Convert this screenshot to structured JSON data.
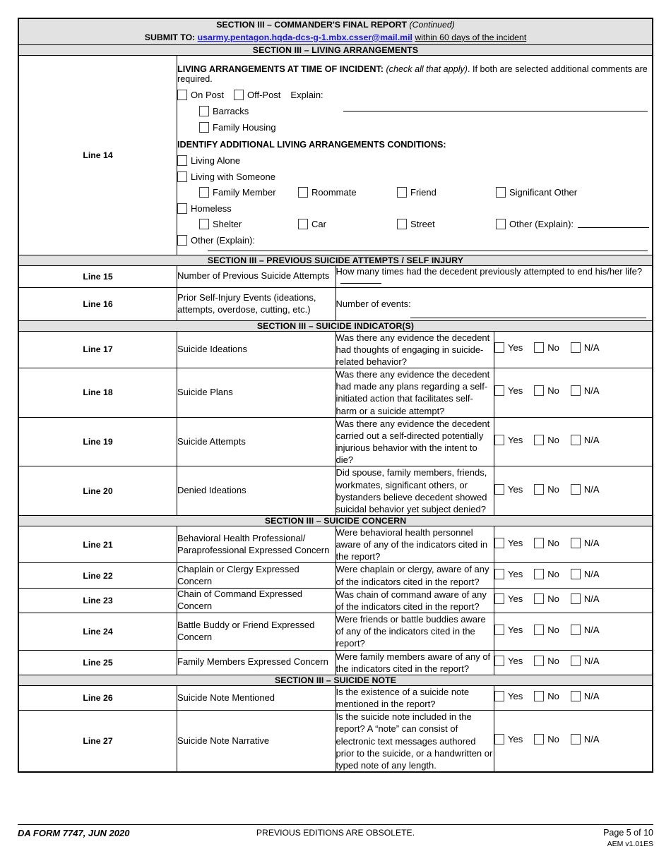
{
  "header": {
    "title_main": "SECTION III – COMMANDER'S FINAL REPORT",
    "title_suffix": "(Continued)",
    "submit_label": "SUBMIT TO:",
    "submit_email": "usarmy.pentagon.hqda-dcs-g-1.mbx.csser@mail.mil",
    "submit_after": "within 60 days of the incident",
    "link_color": "#1a19d6"
  },
  "sections": {
    "living": "SECTION III – LIVING ARRANGEMENTS",
    "previous": "SECTION III – PREVIOUS SUICIDE ATTEMPTS / SELF INJURY",
    "indicators": "SECTION III – SUICIDE INDICATOR(S)",
    "concern": "SECTION III – SUICIDE CONCERN",
    "note": "SECTION III – SUICIDE NOTE"
  },
  "line14": {
    "line_label": "Line 14",
    "heading_bold": "LIVING ARRANGEMENTS AT TIME OF INCIDENT:",
    "heading_italic": "(check all that apply)",
    "heading_rest": ". If both are selected additional comments are required.",
    "on_post": "On Post",
    "off_post": "Off-Post",
    "explain": "Explain:",
    "barracks": "Barracks",
    "family_housing": "Family Housing",
    "conditions_heading": "IDENTIFY ADDITIONAL LIVING ARRANGEMENTS CONDITIONS:",
    "living_alone": "Living Alone",
    "living_with_someone": "Living with Someone",
    "family_member": "Family Member",
    "roommate": "Roommate",
    "friend": "Friend",
    "significant_other": "Significant Other",
    "homeless": "Homeless",
    "shelter": "Shelter",
    "car": "Car",
    "street": "Street",
    "other_explain_homeless": "Other (Explain):",
    "other_explain": "Other (Explain):"
  },
  "line15": {
    "line_label": "Line 15",
    "title": "Number of Previous Suicide Attempts",
    "question": "How many times had the decedent previously attempted to end his/her life?"
  },
  "line16": {
    "line_label": "Line 16",
    "title": "Prior Self-Injury Events (ideations, attempts, overdose, cutting, etc.)",
    "question": "Number of events:"
  },
  "answers": {
    "yes": "Yes",
    "no": "No",
    "na": "N/A"
  },
  "indicator_rows": [
    {
      "line_label": "Line 17",
      "title": "Suicide Ideations",
      "question": "Was there any evidence the decedent had thoughts of engaging in suicide-related behavior?"
    },
    {
      "line_label": "Line 18",
      "title": "Suicide Plans",
      "question": "Was there any evidence the decedent had made any plans regarding a self-initiated action that facilitates self-harm or a suicide attempt?"
    },
    {
      "line_label": "Line 19",
      "title": "Suicide Attempts",
      "question": "Was there any evidence the decedent carried out a self-directed potentially injurious behavior with the intent to die?"
    },
    {
      "line_label": "Line 20",
      "title": "Denied Ideations",
      "question": "Did spouse, family members, friends, workmates, significant others, or bystanders believe decedent showed suicidal behavior yet subject denied?"
    }
  ],
  "concern_rows": [
    {
      "line_label": "Line 21",
      "title": "Behavioral Health Professional/ Paraprofessional Expressed Concern",
      "question": "Were behavioral health personnel aware of any of the indicators cited in the report?"
    },
    {
      "line_label": "Line 22",
      "title": "Chaplain or Clergy Expressed Concern",
      "question": "Were chaplain or clergy, aware of any of the indicators cited in the report?"
    },
    {
      "line_label": "Line 23",
      "title": "Chain of Command Expressed Concern",
      "question": "Was chain of command aware of any of the indicators cited in the report?"
    },
    {
      "line_label": "Line 24",
      "title": "Battle Buddy or Friend Expressed Concern",
      "question": "Were friends or battle buddies aware of any of the indicators cited in the report?"
    },
    {
      "line_label": "Line 25",
      "title": "Family Members Expressed Concern",
      "question": "Were family members aware of any of the indicators cited in the report?"
    }
  ],
  "note_rows": [
    {
      "line_label": "Line 26",
      "title": "Suicide Note Mentioned",
      "question": "Is the existence of a suicide note mentioned in the report?"
    },
    {
      "line_label": "Line 27",
      "title": "Suicide Note Narrative",
      "question": "Is the suicide note included in the report? A “note” can consist of electronic text messages authored prior to the suicide, or a handwritten or typed note of any length."
    }
  ],
  "footer": {
    "form_id": "DA FORM 7747, JUN 2020",
    "previous_editions": "PREVIOUS EDITIONS ARE OBSOLETE.",
    "page": "Page 5 of 10",
    "version": "AEM v1.01ES"
  }
}
